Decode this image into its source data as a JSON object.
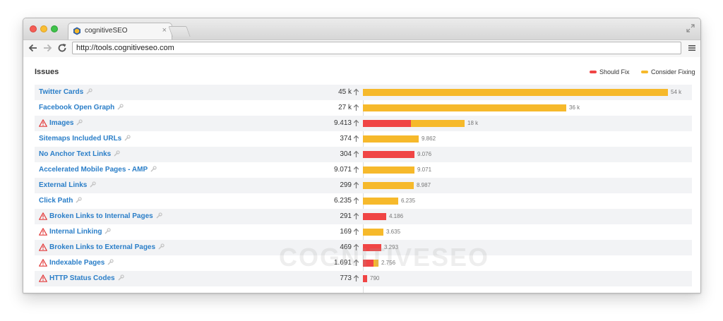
{
  "browser": {
    "tab_title": "cognitiveSEO",
    "tab_close": "×",
    "url": "http://tools.cognitiveseo.com"
  },
  "page": {
    "title": "Issues",
    "watermark": "COGNITIVESEO",
    "legend": [
      {
        "label": "Should Fix",
        "color": "#f04545"
      },
      {
        "label": "Consider Fixing",
        "color": "#f6b92b"
      }
    ]
  },
  "colors": {
    "should_fix": "#f04545",
    "consider_fixing": "#f6b92b",
    "link": "#2a7ec8",
    "warning": "#e33b3b"
  },
  "icons": {
    "warning": "warning-triangle-icon",
    "wrench": "wrench-icon",
    "arrow": "arrow-up-icon"
  },
  "chart_data": {
    "type": "bar",
    "stacked": true,
    "max": 54000,
    "rows": [
      {
        "name": "Twitter Cards",
        "warning": false,
        "count": "45 k",
        "should_fix": 0,
        "consider_fixing": 54000,
        "bar_label": "54 k"
      },
      {
        "name": "Facebook Open Graph",
        "warning": false,
        "count": "27 k",
        "should_fix": 0,
        "consider_fixing": 36000,
        "bar_label": "36 k"
      },
      {
        "name": "Images",
        "warning": true,
        "count": "9.413",
        "should_fix": 8500,
        "consider_fixing": 9500,
        "bar_label": "18 k"
      },
      {
        "name": "Sitemaps Included URLs",
        "warning": false,
        "count": "374",
        "should_fix": 0,
        "consider_fixing": 9862,
        "bar_label": "9.862"
      },
      {
        "name": "No Anchor Text Links",
        "warning": false,
        "count": "304",
        "should_fix": 9076,
        "consider_fixing": 0,
        "bar_label": "9.076"
      },
      {
        "name": "Accelerated Mobile Pages - AMP",
        "warning": false,
        "count": "9.071",
        "should_fix": 0,
        "consider_fixing": 9071,
        "bar_label": "9.071"
      },
      {
        "name": "External Links",
        "warning": false,
        "count": "299",
        "should_fix": 0,
        "consider_fixing": 8987,
        "bar_label": "8.987"
      },
      {
        "name": "Click Path",
        "warning": false,
        "count": "6.235",
        "should_fix": 0,
        "consider_fixing": 6235,
        "bar_label": "6.235"
      },
      {
        "name": "Broken Links to Internal Pages",
        "warning": true,
        "count": "291",
        "should_fix": 4186,
        "consider_fixing": 0,
        "bar_label": "4.186"
      },
      {
        "name": "Internal Linking",
        "warning": true,
        "count": "169",
        "should_fix": 0,
        "consider_fixing": 3635,
        "bar_label": "3.635"
      },
      {
        "name": "Broken Links to External Pages",
        "warning": true,
        "count": "469",
        "should_fix": 3293,
        "consider_fixing": 0,
        "bar_label": "3.293"
      },
      {
        "name": "Indexable Pages",
        "warning": true,
        "count": "1.691",
        "should_fix": 1900,
        "consider_fixing": 856,
        "bar_label": "2.756"
      },
      {
        "name": "HTTP Status Codes",
        "warning": true,
        "count": "773",
        "should_fix": 790,
        "consider_fixing": 0,
        "bar_label": "790"
      }
    ]
  }
}
